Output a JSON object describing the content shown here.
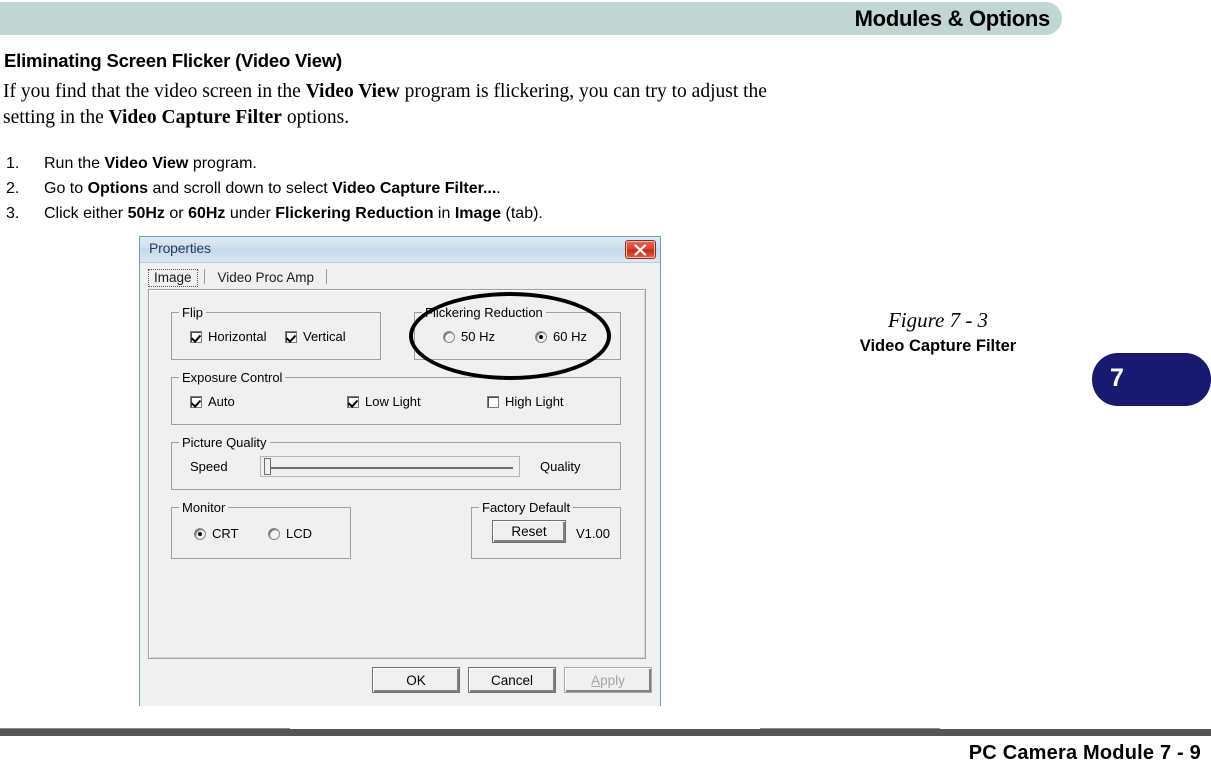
{
  "header": {
    "title": "Modules & Options"
  },
  "document": {
    "heading": "Eliminating Screen Flicker (Video View)",
    "paragraph": {
      "p1": "If you find that the video screen in the ",
      "b1": "Video View",
      "p2": " program is flickering, you can try to adjust the setting in the ",
      "b2": "Video Capture Filter",
      "p3": " options."
    },
    "steps": [
      {
        "number": "1.",
        "parts": [
          {
            "text": "Run the ",
            "bold": false
          },
          {
            "text": "Video View",
            "bold": true
          },
          {
            "text": " program.",
            "bold": false
          }
        ]
      },
      {
        "number": "2.",
        "parts": [
          {
            "text": "Go to ",
            "bold": false
          },
          {
            "text": "Options",
            "bold": true
          },
          {
            "text": " and scroll down to select ",
            "bold": false
          },
          {
            "text": "Video Capture Filter...",
            "bold": true
          },
          {
            "text": ".",
            "bold": false
          }
        ]
      },
      {
        "number": "3.",
        "parts": [
          {
            "text": "Click either ",
            "bold": false
          },
          {
            "text": "50Hz",
            "bold": true
          },
          {
            "text": " or ",
            "bold": false
          },
          {
            "text": "60Hz",
            "bold": true
          },
          {
            "text": " under ",
            "bold": false
          },
          {
            "text": "Flickering Reduction",
            "bold": true
          },
          {
            "text": " in ",
            "bold": false
          },
          {
            "text": "Image",
            "bold": true
          },
          {
            "text": " (tab).",
            "bold": false
          }
        ]
      }
    ]
  },
  "dialog": {
    "title": "Properties",
    "close_label": "Close",
    "tabs": [
      {
        "label": "Image",
        "selected": true
      },
      {
        "label": "Video Proc Amp",
        "selected": false
      }
    ],
    "groups": {
      "flip": {
        "label": "Flip",
        "horizontal": {
          "label": "Horizontal",
          "checked": true
        },
        "vertical": {
          "label": "Vertical",
          "checked": true
        }
      },
      "flickering_reduction": {
        "label": "Flickering Reduction",
        "option_50": {
          "label": "50 Hz",
          "selected": false
        },
        "option_60": {
          "label": "60 Hz",
          "selected": true
        }
      },
      "exposure_control": {
        "label": "Exposure Control",
        "auto": {
          "label": "Auto",
          "checked": true
        },
        "low_light": {
          "label": "Low Light",
          "checked": true
        },
        "high_light": {
          "label": "High Light",
          "checked": false
        }
      },
      "picture_quality": {
        "label": "Picture Quality",
        "left_label": "Speed",
        "right_label": "Quality",
        "value_percent": 0
      },
      "monitor": {
        "label": "Monitor",
        "crt": {
          "label": "CRT",
          "selected": true
        },
        "lcd": {
          "label": "LCD",
          "selected": false
        }
      },
      "factory_default": {
        "label": "Factory Default",
        "reset_label": "Reset",
        "version": "V1.00"
      }
    },
    "buttons": {
      "ok": "OK",
      "cancel": "Cancel",
      "apply_prefix": "A",
      "apply_rest": "pply"
    }
  },
  "figure": {
    "number": "Figure 7 - 3",
    "caption": "Video Capture Filter"
  },
  "chapter_tab": {
    "number": "7",
    "color": "#191970"
  },
  "footer": {
    "text": "PC Camera Module  7  -  9"
  }
}
